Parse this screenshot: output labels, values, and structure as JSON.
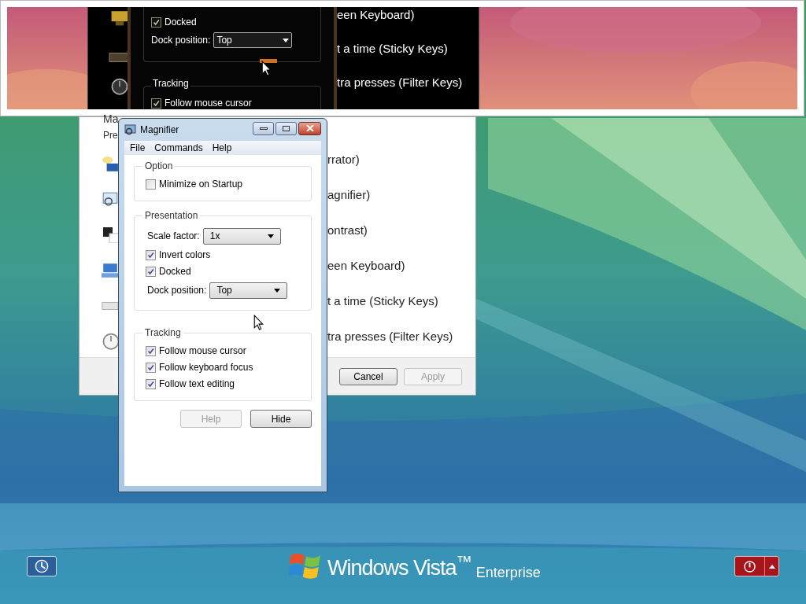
{
  "magnifier_view": {
    "checkbox": {
      "label": "Docked",
      "checked": true
    },
    "dock_label": "Dock position:",
    "dock_value": "Top",
    "group_title": "Tracking",
    "tracking_checkbox": {
      "label": "Follow mouse cursor",
      "checked": true
    },
    "right_texts": [
      "een Keyboard)",
      "t a time (Sticky Keys)",
      "tra presses (Filter Keys)"
    ]
  },
  "background_dialog": {
    "header_texts": [
      "Ma",
      "Pre"
    ],
    "items": [
      "rrator)",
      "agnifier)",
      "ontrast)",
      "een Keyboard)",
      "t a time (Sticky Keys)",
      "tra presses (Filter Keys)"
    ],
    "buttons": [
      {
        "label": "Cancel",
        "disabled": false
      },
      {
        "label": "Apply",
        "disabled": true
      }
    ]
  },
  "magnifier": {
    "title": "Magnifier",
    "menu": [
      "File",
      "Commands",
      "Help"
    ],
    "groups": [
      {
        "title": "Option",
        "rows": [
          {
            "kind": "checkbox",
            "label": "Minimize on Startup",
            "checked": false
          }
        ]
      },
      {
        "title": "Presentation",
        "rows": [
          {
            "kind": "select",
            "label": "Scale factor:",
            "value": "1x"
          },
          {
            "kind": "checkbox",
            "label": "Invert colors",
            "checked": true
          },
          {
            "kind": "checkbox",
            "label": "Docked",
            "checked": true
          },
          {
            "kind": "select",
            "label": "Dock position:",
            "value": "Top"
          }
        ]
      },
      {
        "title": "Tracking",
        "rows": [
          {
            "kind": "checkbox",
            "label": "Follow mouse cursor",
            "checked": true
          },
          {
            "kind": "checkbox",
            "label": "Follow keyboard focus",
            "checked": true
          },
          {
            "kind": "checkbox",
            "label": "Follow text editing",
            "checked": true
          }
        ]
      }
    ],
    "buttons": [
      {
        "label": "Help",
        "disabled": true
      },
      {
        "label": "Hide",
        "disabled": false
      }
    ]
  },
  "login": {
    "brand": "Windows Vista$^{™}$",
    "edition": "Enterprise"
  }
}
